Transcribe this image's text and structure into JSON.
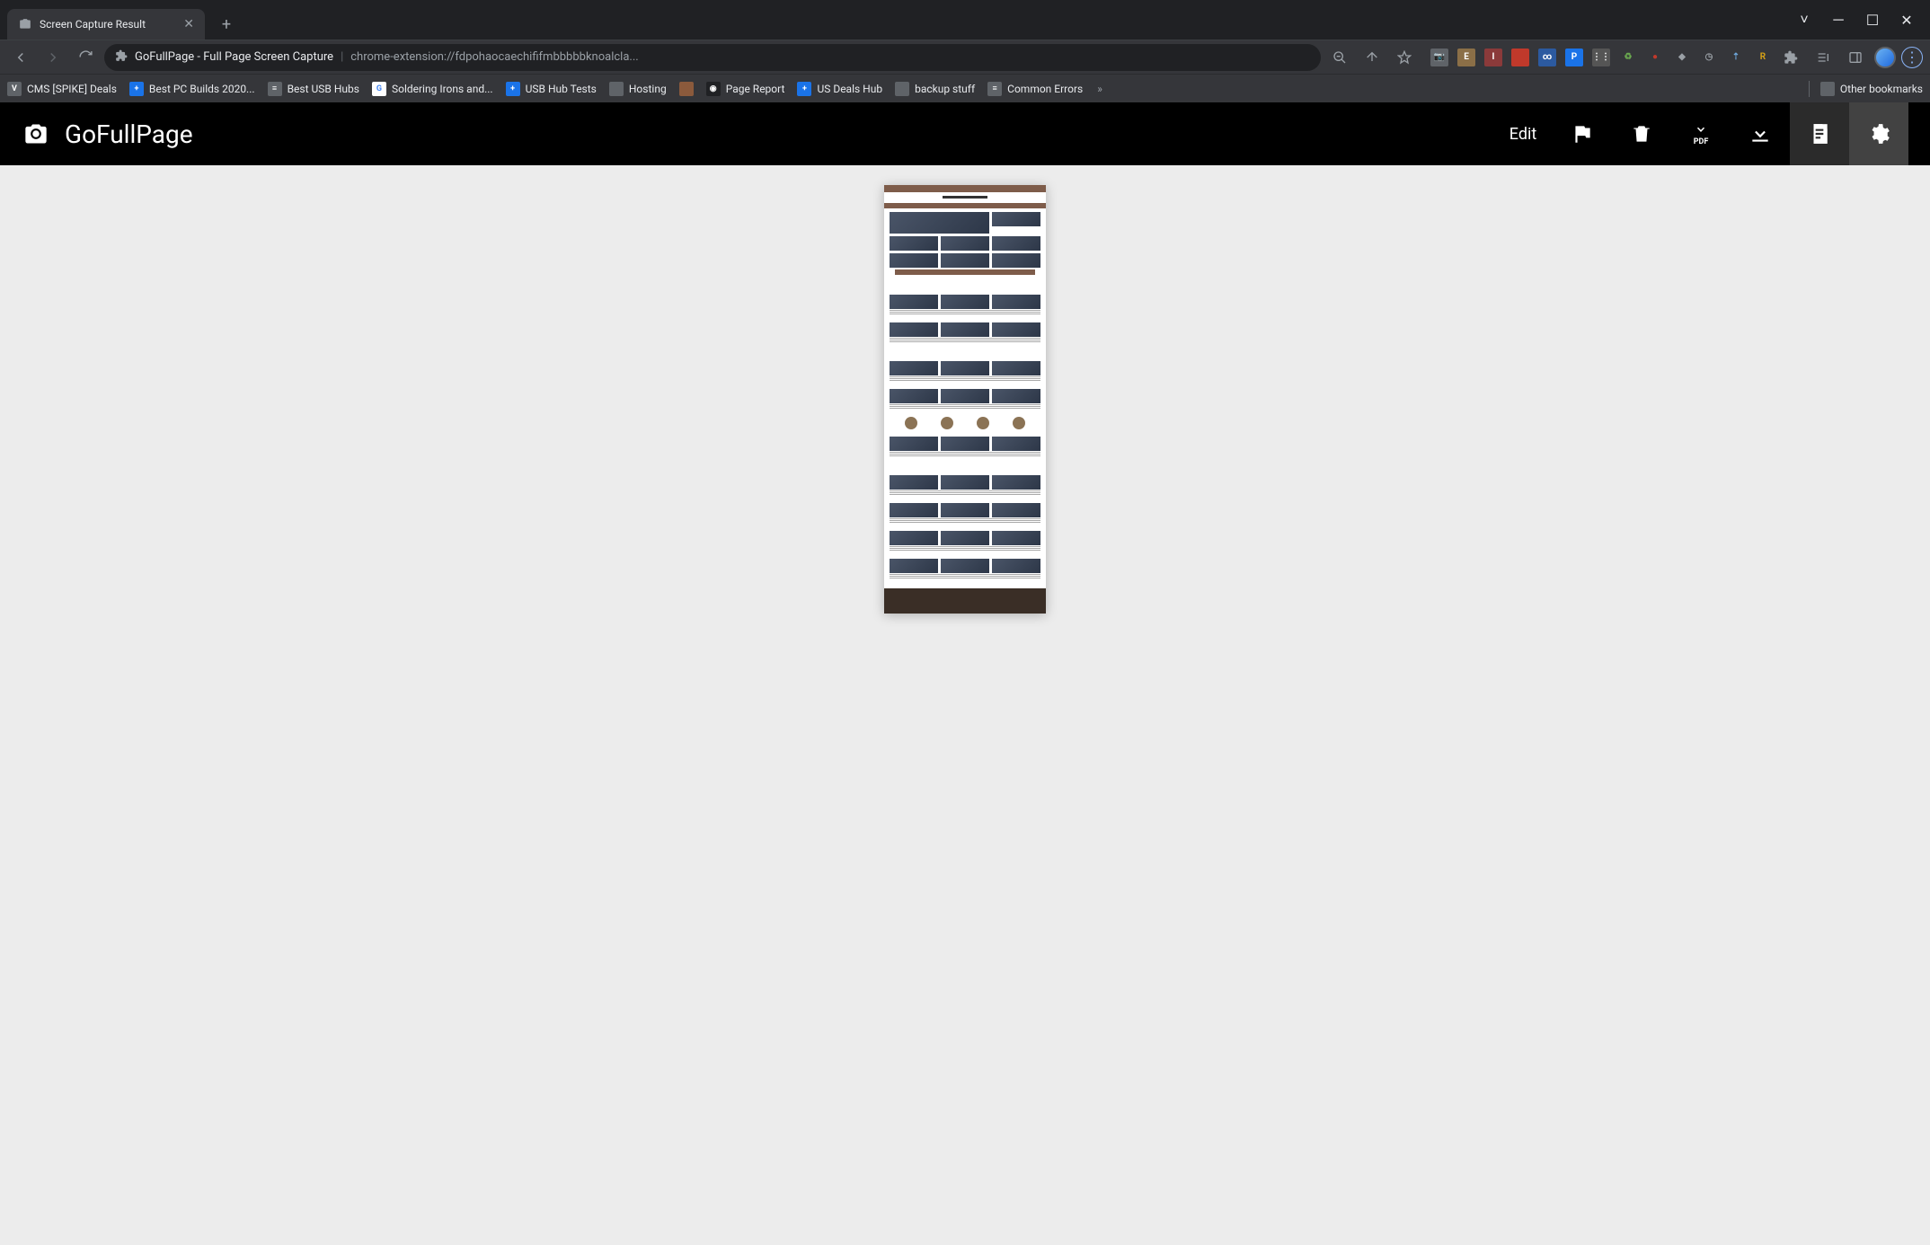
{
  "tab": {
    "title": "Screen Capture Result"
  },
  "address": {
    "page_title": "GoFullPage - Full Page Screen Capture",
    "url": "chrome-extension://fdpohaocaechififmbbbbbknoalcla..."
  },
  "bookmarks": [
    {
      "label": "CMS [SPIKE] Deals",
      "bg": "#5f6368",
      "fg": "#fff",
      "ch": "V"
    },
    {
      "label": "Best PC Builds 2020...",
      "bg": "#1a73e8",
      "fg": "#fff",
      "ch": "+"
    },
    {
      "label": "Best USB Hubs",
      "bg": "#5f6368",
      "fg": "#fff",
      "ch": "≡"
    },
    {
      "label": "Soldering Irons and...",
      "bg": "#fff",
      "fg": "#4285f4",
      "ch": "G"
    },
    {
      "label": "USB Hub Tests",
      "bg": "#1a73e8",
      "fg": "#fff",
      "ch": "+"
    },
    {
      "label": "Hosting",
      "bg": "#5f6368",
      "fg": "#fff",
      "ch": ""
    },
    {
      "label": "",
      "bg": "#8b5a3c",
      "fg": "#fff",
      "ch": ""
    },
    {
      "label": "Page Report",
      "bg": "#202124",
      "fg": "#fff",
      "ch": "◉"
    },
    {
      "label": "US Deals Hub",
      "bg": "#1a73e8",
      "fg": "#fff",
      "ch": "+"
    },
    {
      "label": "backup stuff",
      "bg": "#5f6368",
      "fg": "#fff",
      "ch": ""
    },
    {
      "label": "Common  Errors",
      "bg": "#5f6368",
      "fg": "#fff",
      "ch": "≡"
    }
  ],
  "bookmarks_overflow": "»",
  "other_bookmarks": "Other bookmarks",
  "app": {
    "brand": "GoFullPage",
    "actions": {
      "edit": "Edit",
      "pdf": "PDF"
    }
  },
  "ext_icons": [
    {
      "bg": "#5f6368",
      "fg": "#fff",
      "ch": "📷"
    },
    {
      "bg": "#8b6f47",
      "fg": "#fff",
      "ch": "E"
    },
    {
      "bg": "#8b3a3a",
      "fg": "#fff",
      "ch": "I"
    },
    {
      "bg": "#c0392b",
      "fg": "#fff",
      "ch": ""
    },
    {
      "bg": "#2c5aa0",
      "fg": "#fff",
      "ch": "∞"
    },
    {
      "bg": "#1a73e8",
      "fg": "#fff",
      "ch": "P"
    },
    {
      "bg": "#555",
      "fg": "#fff",
      "ch": "⋮⋮"
    },
    {
      "bg": "transparent",
      "fg": "#6aa84f",
      "ch": "♻"
    },
    {
      "bg": "transparent",
      "fg": "#c0392b",
      "ch": "●"
    },
    {
      "bg": "transparent",
      "fg": "#9aa0a6",
      "ch": "◆"
    },
    {
      "bg": "transparent",
      "fg": "#9aa0a6",
      "ch": "◷"
    },
    {
      "bg": "transparent",
      "fg": "#6fa8dc",
      "ch": "⇡"
    },
    {
      "bg": "transparent",
      "fg": "#d4a017",
      "ch": "R"
    }
  ]
}
